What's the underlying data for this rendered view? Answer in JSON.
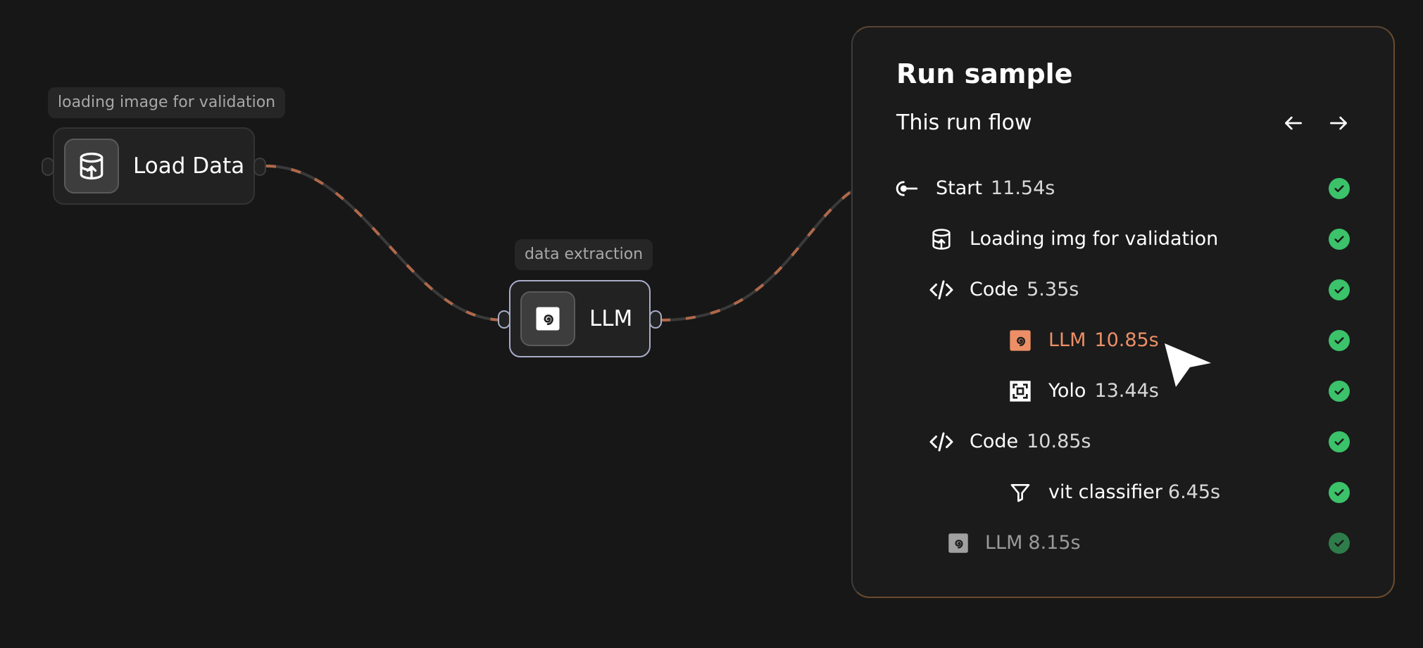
{
  "canvas": {
    "nodes": [
      {
        "label": "loading image for validation",
        "title": "Load Data",
        "icon": "database-upload-icon"
      },
      {
        "label": "data extraction",
        "title": "LLM",
        "icon": "spiral-icon"
      }
    ]
  },
  "panel": {
    "title": "Run sample",
    "subtitle": "This run flow",
    "prev_icon": "arrow-left-icon",
    "next_icon": "arrow-right-icon",
    "steps": [
      {
        "name": "Start",
        "time": "11.54s",
        "icon": "start-key-icon",
        "status": "success"
      },
      {
        "name": "Loading img for validation",
        "time": "",
        "icon": "database-upload-icon",
        "status": "success"
      },
      {
        "name": "Code",
        "time": "5.35s",
        "icon": "code-icon",
        "status": "success"
      },
      {
        "name": "LLM",
        "time": "10.85s",
        "icon": "spiral-icon",
        "status": "success",
        "active": true
      },
      {
        "name": "Yolo",
        "time": "13.44s",
        "icon": "focus-frame-icon",
        "status": "success"
      },
      {
        "name": "Code",
        "time": "10.85s",
        "icon": "code-icon",
        "status": "success"
      },
      {
        "name": "vit classifier",
        "time": "6.45s",
        "icon": "filter-icon",
        "status": "success"
      },
      {
        "name": "LLM",
        "time": "8.15s",
        "icon": "spiral-icon",
        "status": "success"
      }
    ]
  },
  "colors": {
    "background": "#171717",
    "accent": "#ec8f66",
    "success": "#3bc26a",
    "selected_border": "#a9adc8"
  }
}
